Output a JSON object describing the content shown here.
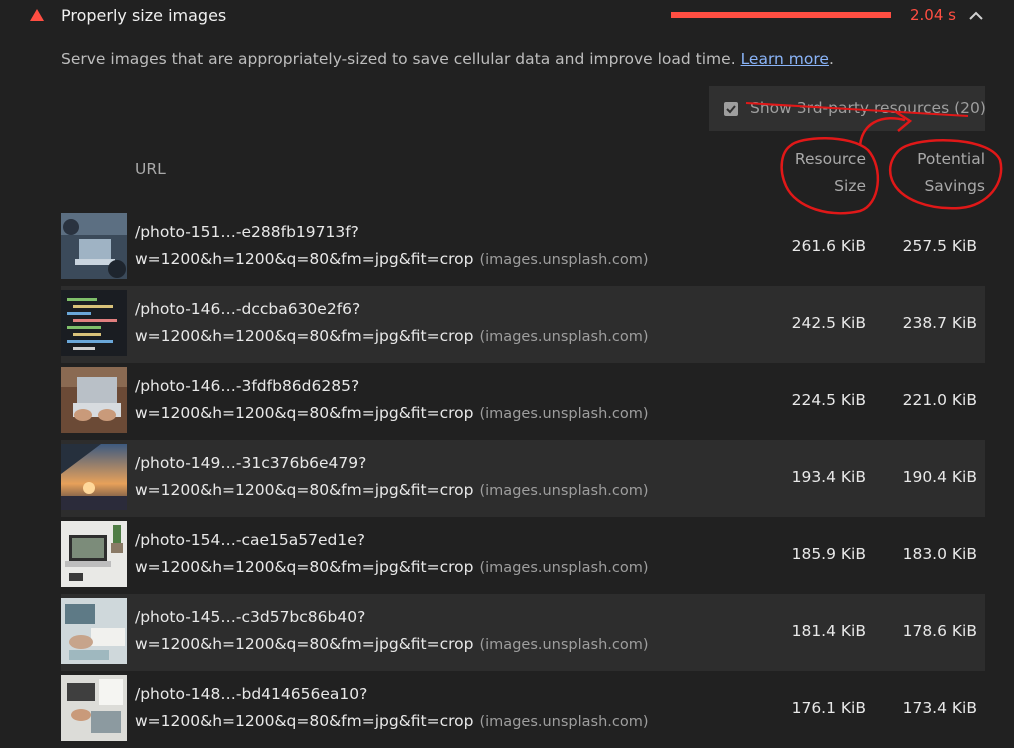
{
  "audit": {
    "title": "Properly size images",
    "savings": "2.04 s",
    "savings_fraction": 0.9,
    "accent_color": "#ff4e42",
    "description": "Serve images that are appropriately-sized to save cellular data and improve load time.",
    "learn_more": "Learn more",
    "period": ".",
    "third_party_label": "Show 3rd-party resources (20)",
    "third_party_checked": true
  },
  "table": {
    "headers": {
      "url": "URL",
      "size_line1": "Resource",
      "size_line2": "Size",
      "savings_line1": "Potential",
      "savings_line2": "Savings"
    },
    "rows": [
      {
        "path": "/photo-151…-e288fb19713f?",
        "query": "w=1200&h=1200&q=80&fm=jpg&fit=crop",
        "host": "(images.unsplash.com)",
        "size": "261.6 KiB",
        "savings": "257.5 KiB",
        "thumb": "laptop-desk"
      },
      {
        "path": "/photo-146…-dccba630e2f6?",
        "query": "w=1200&h=1200&q=80&fm=jpg&fit=crop",
        "host": "(images.unsplash.com)",
        "size": "242.5 KiB",
        "savings": "238.7 KiB",
        "thumb": "code-screen"
      },
      {
        "path": "/photo-146…-3fdfb86d6285?",
        "query": "w=1200&h=1200&q=80&fm=jpg&fit=crop",
        "host": "(images.unsplash.com)",
        "size": "224.5 KiB",
        "savings": "221.0 KiB",
        "thumb": "typing-laptop"
      },
      {
        "path": "/photo-149…-31c376b6e479?",
        "query": "w=1200&h=1200&q=80&fm=jpg&fit=crop",
        "host": "(images.unsplash.com)",
        "size": "193.4 KiB",
        "savings": "190.4 KiB",
        "thumb": "sunset"
      },
      {
        "path": "/photo-154…-cae15a57ed1e?",
        "query": "w=1200&h=1200&q=80&fm=jpg&fit=crop",
        "host": "(images.unsplash.com)",
        "size": "185.9 KiB",
        "savings": "183.0 KiB",
        "thumb": "laptop-plant"
      },
      {
        "path": "/photo-145…-c3d57bc86b40?",
        "query": "w=1200&h=1200&q=80&fm=jpg&fit=crop",
        "host": "(images.unsplash.com)",
        "size": "181.4 KiB",
        "savings": "178.6 KiB",
        "thumb": "hands-notebook"
      },
      {
        "path": "/photo-148…-bd414656ea10?",
        "query": "w=1200&h=1200&q=80&fm=jpg&fit=crop",
        "host": "(images.unsplash.com)",
        "size": "176.1 KiB",
        "savings": "173.4 KiB",
        "thumb": "workspace"
      }
    ]
  }
}
